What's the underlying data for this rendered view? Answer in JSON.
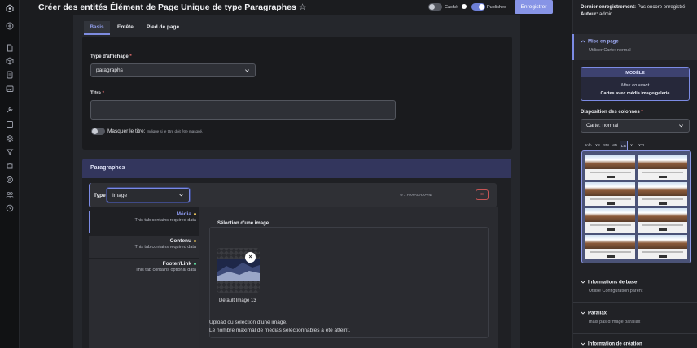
{
  "header": {
    "title": "Créer des entités Élément de Page Unique de type Paragraphes",
    "star_icon": "star-icon",
    "hidden_label": "Caché",
    "published_label": "Published",
    "save_label": "Enregistrer",
    "hidden_toggle_on": false,
    "published_toggle_on": true
  },
  "rail_icons": [
    "app-logo-icon",
    "add-icon",
    "file-icon",
    "cube-icon",
    "document-icon",
    "image-gallery-icon",
    "wrench-icon",
    "square-icon",
    "layers-icon",
    "filter-icon",
    "puzzle-icon",
    "settings-icon",
    "users-icon",
    "history-icon"
  ],
  "tabs": [
    {
      "label": "Basis",
      "active": true
    },
    {
      "label": "Entête",
      "active": false
    },
    {
      "label": "Pied de page",
      "active": false
    }
  ],
  "basis": {
    "display_type_label": "Type d'affichage",
    "display_type_value": "paragraphs",
    "title_label": "Titre",
    "title_value": "",
    "hide_title_label": "Masquer le titre:",
    "hide_title_hint": "Indique si le titre doit être masqué."
  },
  "paragraphs": {
    "section_title": "Paragraphes",
    "type_label": "Type",
    "type_value": "Image",
    "count_label": "1 PARAGRAPHE",
    "sub_tabs": [
      {
        "title": "Média",
        "note": "This tab contains required data",
        "dot_color": "#e7c15b"
      },
      {
        "title": "Contenu",
        "note": "This tab contains required data",
        "dot_color": "#e7c15b"
      },
      {
        "title": "Footer/Link",
        "note": "This tab contains optional data",
        "dot_color": "#5fd39a"
      }
    ],
    "media_legend": "Sélection d'une image",
    "thumb_caption": "Default Image 13",
    "message_line1": "Upload ou sélection d'une image.",
    "message_line2": "Le nombre maximal de médias sélectionnables a été atteint."
  },
  "sidebar": {
    "last_saved_label": "Dernier enregistrement:",
    "last_saved_value": "Pas encore enregistré",
    "author_label": "Auteur:",
    "author_value": "admin",
    "layout_title": "Mise en page",
    "layout_sub": "Utiliser Carte: normal",
    "model_head": "MODÈLE",
    "model_line1": "Mise en avant",
    "model_line2": "Cartes avec média image/galerie",
    "columns_label": "Disposition des colonnes",
    "columns_value": "Carte: normal",
    "breakpoints": [
      "Info",
      "XS",
      "SM",
      "MD",
      "LG",
      "XL",
      "XXL"
    ],
    "active_breakpoint": "LG",
    "sections": [
      {
        "title": "Informations de base",
        "sub": "Utilise Configuration parent"
      },
      {
        "title": "Parallax",
        "sub": "mais pas d'image parallax"
      },
      {
        "title": "Information de création",
        "sub": ""
      }
    ]
  }
}
